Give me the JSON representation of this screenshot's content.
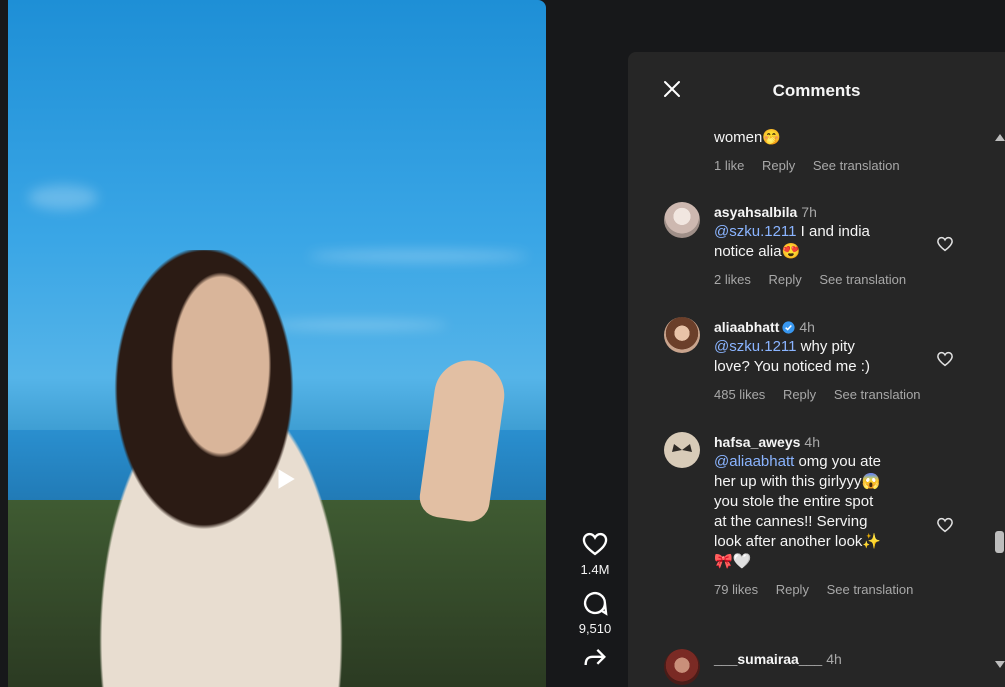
{
  "video": {
    "play_icon": "play-icon"
  },
  "actions": {
    "likes": "1.4M",
    "comments": "9,510"
  },
  "panel": {
    "title": "Comments",
    "close_icon": "close-icon"
  },
  "comments": [
    {
      "user": "",
      "time": "",
      "text": "women🤭",
      "likes": "1 like",
      "reply": "Reply",
      "translation": "See translation"
    },
    {
      "user": "asyahsalbila",
      "time": "7h",
      "mention": "@szku.1211",
      "text": " I and india notice alia😍",
      "likes": "2 likes",
      "reply": "Reply",
      "translation": "See translation"
    },
    {
      "user": "aliaabhatt",
      "time": "4h",
      "verified": true,
      "mention": "@szku.1211",
      "text": " why pity love? You noticed me :)",
      "likes": "485 likes",
      "reply": "Reply",
      "translation": "See translation"
    },
    {
      "user": "hafsa_aweys",
      "time": "4h",
      "mention": "@aliaabhatt",
      "text": " omg you ate her up with this girlyyy😱 you stole the entire spot at the cannes!! Serving look after another look✨🎀🤍",
      "likes": "79 likes",
      "reply": "Reply",
      "translation": "See translation"
    },
    {
      "user": "___sumairaa___",
      "time": "4h"
    }
  ]
}
